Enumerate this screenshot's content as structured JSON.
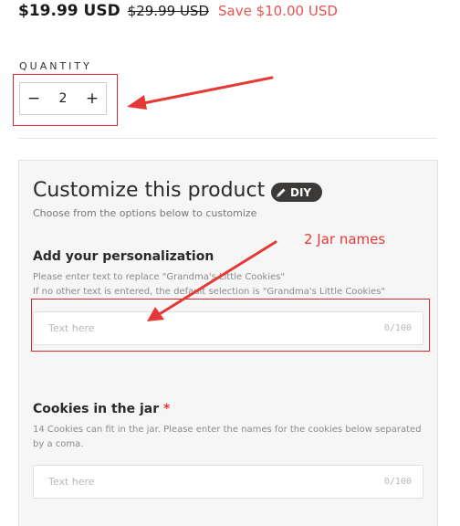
{
  "price": {
    "current": "$19.99 USD",
    "compare_at": "$29.99 USD",
    "savings": "Save $10.00 USD"
  },
  "quantity": {
    "label": "QUANTITY",
    "decrease_symbol": "−",
    "value": "2",
    "increase_symbol": "+"
  },
  "customize": {
    "title": "Customize this product",
    "badge": "DIY",
    "subtitle": "Choose from the options below to customize",
    "personalization": {
      "title": "Add your personalization",
      "help_line_1": "Please enter text to replace \"Grandma's Little Cookies\"",
      "help_line_2": "If no other text is entered, the default selection is \"Grandma's Little Cookies\"",
      "placeholder": "Text here",
      "counter": "0/100"
    },
    "cookies": {
      "title": "Cookies in the jar",
      "required_mark": "*",
      "help": "14 Cookies can fit in the jar. Please enter the names for the cookies below separated by a coma.",
      "placeholder": "Text here",
      "counter": "0/100"
    }
  },
  "annotations": {
    "note": "2 Jar names",
    "color": "#e53935"
  },
  "colors": {
    "sale": "#e8534f",
    "badge_bg": "#3b3a38",
    "panel_bg": "#f6f6f6"
  }
}
